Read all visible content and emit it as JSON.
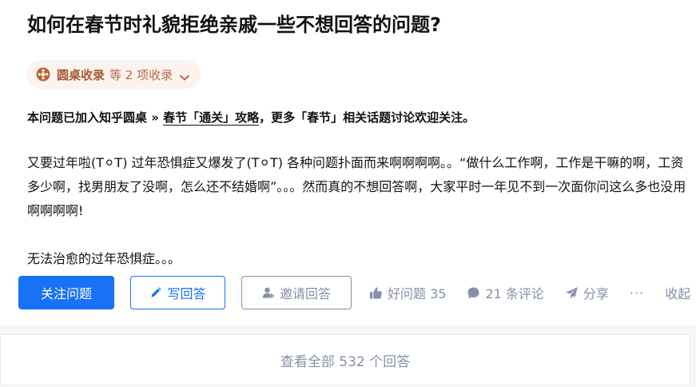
{
  "question": {
    "title": "如何在春节时礼貌拒绝亲戚一些不想回答的问题?"
  },
  "roundtable_chip": {
    "name": "圆桌收录",
    "count_text": "等 2 项收录"
  },
  "notice": {
    "prefix": "本问题已加入知乎圆桌 » ",
    "link": "春节「通关」攻略",
    "suffix": "，更多「春节」相关话题讨论欢迎关注。"
  },
  "description": {
    "p1": "又要过年啦(T⚪T) 过年恐惧症又爆发了(T⚪T) 各种问题扑面而来啊啊啊啊。。“做什么工作啊，工作是干嘛的啊，工资多少啊，找男朋友了没啊，怎么还不结婚啊”。。。然而真的不想回答啊，大家平时一年见不到一次面你问这么多也没用啊啊啊啊!",
    "p2": "无法治愈的过年恐惧症。。。"
  },
  "actions": {
    "follow": "关注问题",
    "write": "写回答",
    "invite": "邀请回答",
    "good_question": "好问题 35",
    "comments": "21 条评论",
    "share": "分享",
    "more": "···",
    "collect": "收起"
  },
  "view_all": "查看全部 532 个回答",
  "colors": {
    "primary": "#1772f6",
    "muted": "#8590a6",
    "roundtable_bg": "#fbf3ee",
    "roundtable_text": "#a85a37"
  },
  "icons": {
    "roundtable": "roundtable-icon",
    "chevron": "chevron-down-icon",
    "pencil": "pencil-icon",
    "invite": "add-user-icon",
    "thumb": "thumb-up-icon",
    "comment": "comment-icon",
    "share": "share-icon"
  }
}
